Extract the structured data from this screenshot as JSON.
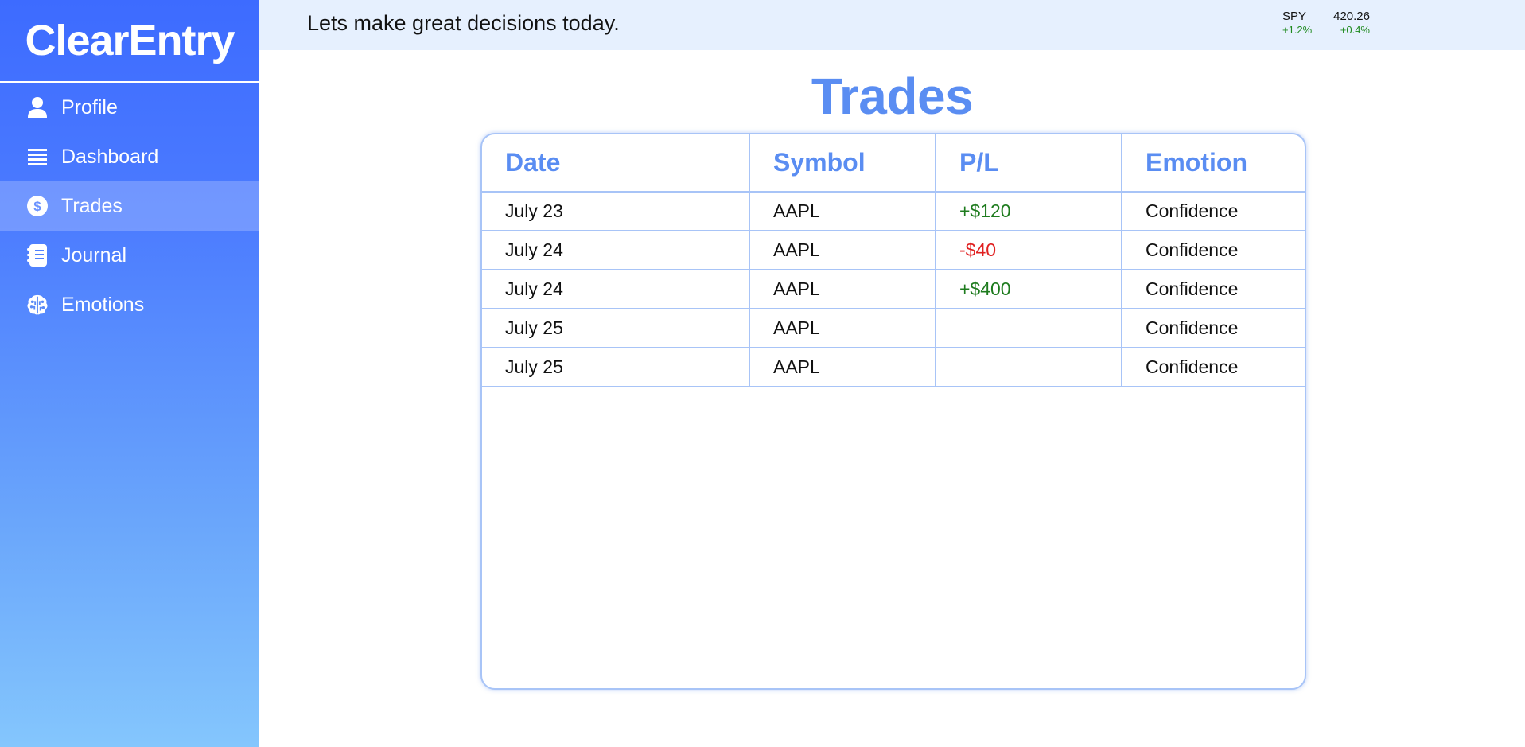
{
  "sidebar": {
    "brand": "ClearEntry",
    "items": [
      {
        "label": "Profile",
        "icon": "user-icon"
      },
      {
        "label": "Dashboard",
        "icon": "list-icon"
      },
      {
        "label": "Trades",
        "icon": "dollar-circle-icon",
        "active": true
      },
      {
        "label": "Journal",
        "icon": "notebook-icon"
      },
      {
        "label": "Emotions",
        "icon": "brain-icon"
      }
    ]
  },
  "header": {
    "greeting": "Lets make great decisions today.",
    "ticker": {
      "symbol": "SPY",
      "price": "420.26",
      "change1": "+1.2%",
      "change2": "+0.4%"
    }
  },
  "main": {
    "title": "Trades",
    "table": {
      "columns": [
        "Date",
        "Symbol",
        "P/L",
        "Emotion"
      ],
      "rows": [
        {
          "date": "July 23",
          "symbol": "AAPL",
          "pl": "+$120",
          "emotion": "Confidence"
        },
        {
          "date": "July 24",
          "symbol": "AAPL",
          "pl": "-$40",
          "emotion": "Confidence"
        },
        {
          "date": "July 24",
          "symbol": "AAPL",
          "pl": "+$400",
          "emotion": "Confidence"
        },
        {
          "date": "July 25",
          "symbol": "AAPL",
          "pl": "",
          "emotion": "Confidence"
        },
        {
          "date": "July 25",
          "symbol": "AAPL",
          "pl": "",
          "emotion": "Confidence"
        }
      ]
    }
  },
  "colors": {
    "accent": "#5a8df2",
    "sidebar_top": "#3d6bff",
    "sidebar_bottom": "#84c6fd",
    "positive": "#1e7b1e",
    "negative": "#e02020",
    "topbar_bg": "#e6f0fe"
  }
}
